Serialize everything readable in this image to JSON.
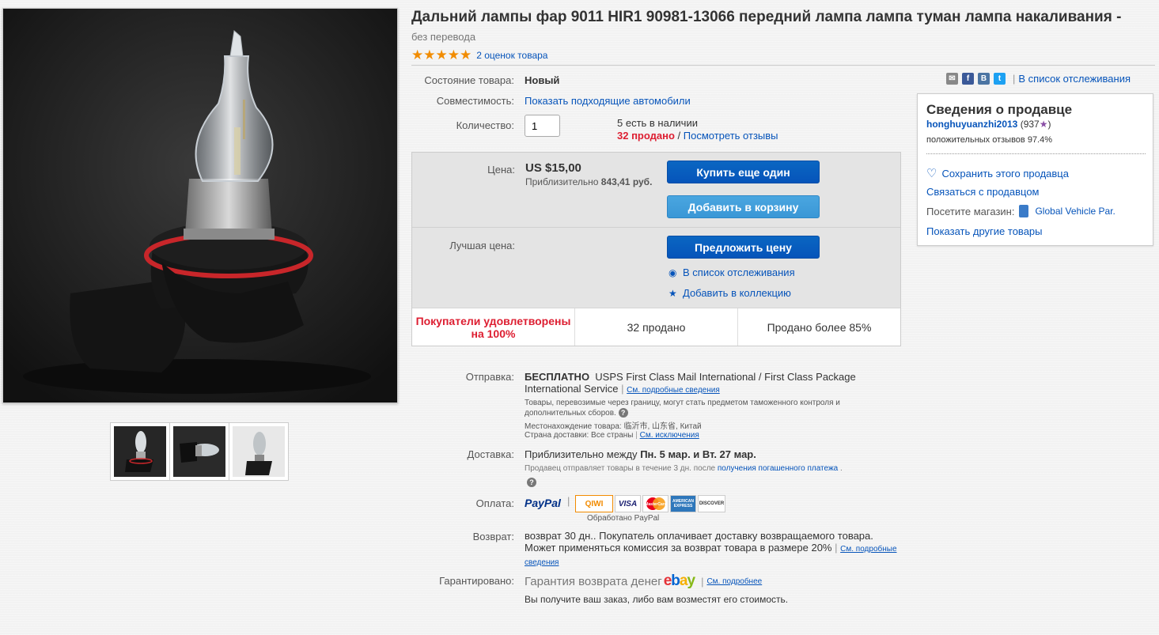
{
  "product": {
    "title": "Дальний лампы фар 9011 HIR1 90981-13066 передний лампа лампа туман лампа накаливания -",
    "title_note": "без перевода",
    "stars": "★★★★★",
    "rating_link": "2 оценок товара"
  },
  "attributes": {
    "condition_label": "Состояние товара:",
    "condition_value": "Новый",
    "compat_label": "Совместимость:",
    "compat_link": "Показать подходящие автомобили",
    "qty_label": "Количество:",
    "qty_value": "1",
    "available": "5 есть в наличии",
    "sold_count": "32 продано",
    "sep": " / ",
    "reviews_link": "Посмотреть отзывы"
  },
  "buy_box": {
    "price_label": "Цена:",
    "price": "US $15,00",
    "approx_prefix": "Приблизительно",
    "approx_value": "843,41 руб.",
    "buy_button": "Купить еще один",
    "cart_button": "Добавить в корзину",
    "best_offer_label": "Лучшая цена:",
    "offer_button": "Предложить цену",
    "watch_link": "В список отслеживания",
    "collection_link": "Добавить в коллекцию",
    "stats": {
      "satisfied": "Покупатели удовлетворены на 100%",
      "sold": "32 продано",
      "sold_over": "Продано более 85%"
    }
  },
  "shipping": {
    "label": "Отправка:",
    "free": "БЕСПЛАТНО",
    "service": "USPS First Class Mail International / First Class Package International Service",
    "details_link": "См. подробные сведения",
    "customs_note": "Товары, перевозимые через границу, могут стать предметом таможенного контроля и дополнительных сборов.",
    "location_label": "Местонахождение товара:",
    "location_value": "临沂市, 山东省, Китай",
    "ship_to_label": "Страна доставки:",
    "ship_to_value": "Все страны",
    "exclusions_link": "См. исключения"
  },
  "delivery": {
    "label": "Доставка:",
    "prefix": "Приблизительно между",
    "dates": "Пн. 5 мар. и Вт. 27 мар.",
    "note": "Продавец отправляет товары в течение 3 дн. после",
    "note_link": "получения погашенного платежа",
    "note_end": "."
  },
  "payment": {
    "label": "Оплата:",
    "paypal": "PayPal",
    "qiwi": "QIWI",
    "visa": "VISA",
    "mastercard": "MasterCard",
    "amex": "AMERICAN EXPRESS",
    "discover": "DISCOVER",
    "processed": "Обработано PayPal"
  },
  "returns": {
    "label": "Возврат:",
    "text": "возврат 30 дн.. Покупатель оплачивает доставку возвращаемого товара. Может применяться комиссия за возврат товара в размере 20%",
    "details_link": "См. подробные сведения"
  },
  "guarantee": {
    "label": "Гарантировано:",
    "text": "Гарантия возврата денег",
    "ebay": "ebay",
    "more_link": "См. подробнее",
    "sub": "Вы получите ваш заказ, либо вам возместят его стоимость."
  },
  "seller": {
    "watch_link": "В список отслеживания",
    "heading": "Сведения о продавце",
    "name": "honghuyuanzhi2013",
    "score": "(937",
    "score_end": ")",
    "feedback": "положительных отзывов 97.4%",
    "save": "Сохранить этого продавца",
    "contact": "Связаться с продавцом",
    "visit_label": "Посетите магазин:",
    "store": "Global Vehicle Par.",
    "other_items": "Показать другие товары"
  },
  "colors": {
    "link": "#0654ba",
    "primary_button": "#0654ba",
    "secondary_button": "#3a97d6",
    "stars": "#f18c00",
    "sold_red": "#dd1e31"
  }
}
